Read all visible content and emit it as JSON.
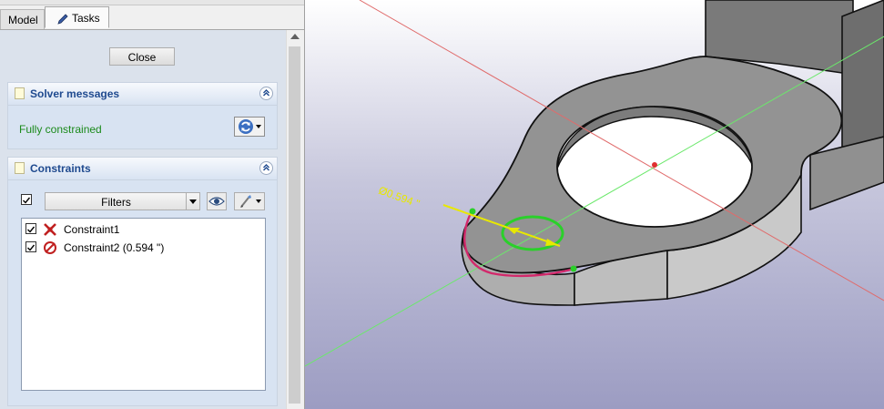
{
  "tabs": {
    "model": "Model",
    "tasks": "Tasks"
  },
  "task_panel": {
    "close_label": "Close",
    "solver": {
      "title": "Solver messages",
      "status": "Fully constrained"
    },
    "constraints": {
      "title": "Constraints",
      "filter_label": "Filters",
      "items": [
        {
          "label": "Constraint1",
          "icon": "coincident-constraint-icon",
          "checked": true
        },
        {
          "label": "Constraint2 (0.594 \")",
          "icon": "diameter-constraint-icon",
          "checked": true
        }
      ]
    }
  },
  "viewport": {
    "dimension_label": "Ø0.594 \""
  },
  "colors": {
    "header_title": "#1f4a8f",
    "status_ok": "#1b8a1b",
    "constraint_highlight": "#d2296b",
    "sketch_green": "#2ad02a",
    "dimension_yellow": "#e8e800"
  }
}
